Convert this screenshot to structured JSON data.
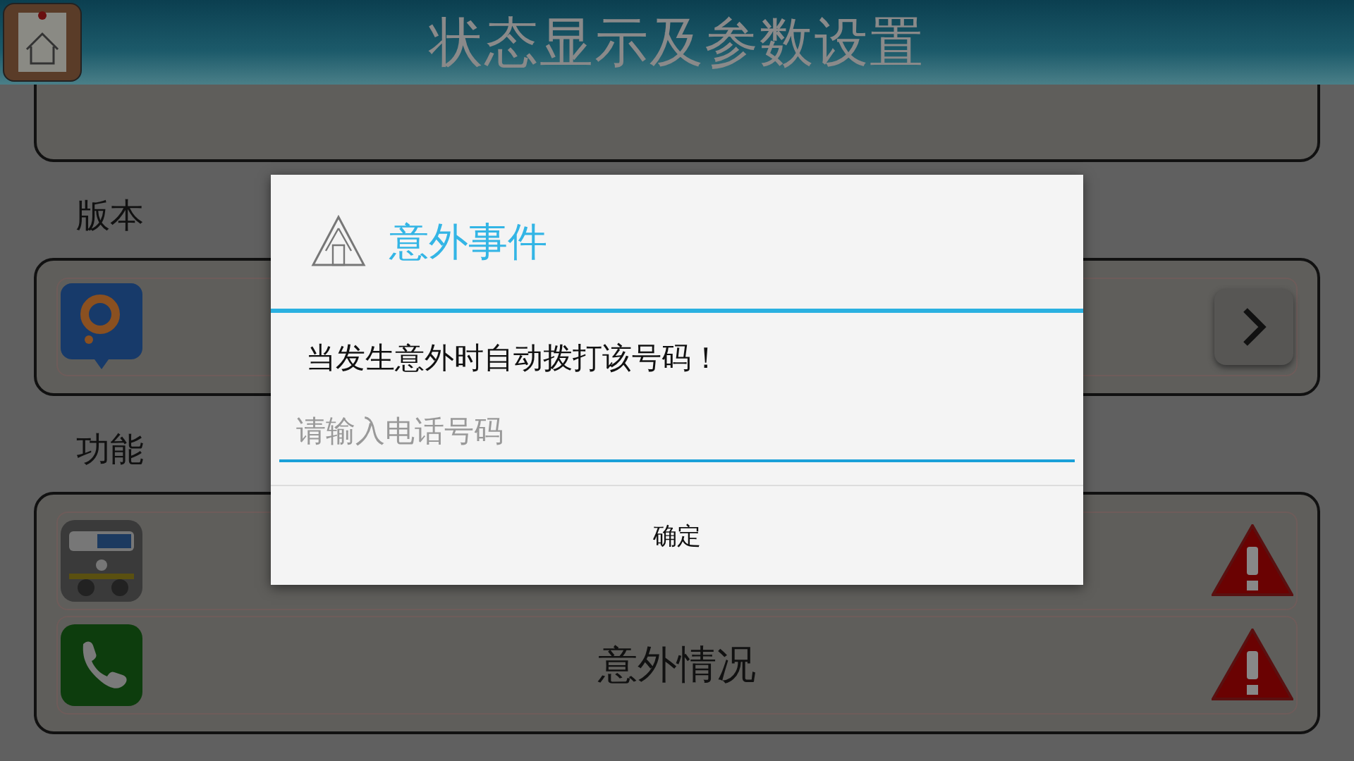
{
  "header": {
    "title": "状态显示及参数设置"
  },
  "sections": [
    {
      "label": "版本",
      "rows": [
        {
          "kind": "link"
        }
      ]
    },
    {
      "label": "功能",
      "rows": [
        {
          "kind": "alert"
        },
        {
          "kind": "alert",
          "title": "意外情况"
        }
      ]
    }
  ],
  "dialog": {
    "title": "意外事件",
    "message": "当发生意外时自动拨打该号码！",
    "input": {
      "placeholder": "请输入电话号码"
    },
    "buttons": [
      "确定"
    ]
  }
}
